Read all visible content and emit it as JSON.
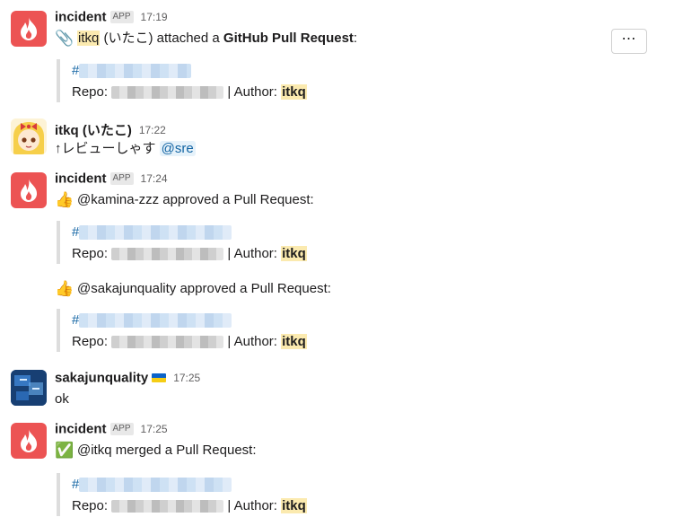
{
  "messages": [
    {
      "author": "incident",
      "badge": "APP",
      "time": "17:19",
      "emoji": "📎",
      "user_highlight": "itkq",
      "text_mid": " (いたこ) attached a ",
      "text_bold": "GitHub Pull Request",
      "text_end": ":",
      "quote": {
        "hash": "#",
        "repo_label": "Repo: ",
        "author_label": " | Author: ",
        "author": "itkq"
      }
    },
    {
      "author": "itkq (いたこ)",
      "time": "17:22",
      "text": "↑レビューしゃす ",
      "mention": "@sre"
    },
    {
      "author": "incident",
      "badge": "APP",
      "time": "17:24",
      "emoji": "👍",
      "text": "@kamina-zzz approved a Pull Request:",
      "quote": {
        "hash": "#",
        "repo_label": "Repo: ",
        "author_label": " | Author: ",
        "author": "itkq"
      },
      "emoji2": "👍",
      "text2": "@sakajunquality approved a Pull Request:",
      "quote2": {
        "hash": "#",
        "repo_label": "Repo: ",
        "author_label": " | Author: ",
        "author": "itkq"
      }
    },
    {
      "author": "sakajunquality",
      "flag": "ukraine-flag-icon",
      "time": "17:25",
      "text": "ok"
    },
    {
      "author": "incident",
      "badge": "APP",
      "time": "17:25",
      "emoji": "✅",
      "text": "@itkq merged a Pull Request:",
      "quote": {
        "hash": "#",
        "repo_label": "Repo: ",
        "author_label": " | Author: ",
        "author": "itkq"
      }
    }
  ],
  "actions": {
    "more_label": "⋯"
  },
  "colors": {
    "incident_avatar": "#ec5353",
    "link": "#1264a3",
    "highlight": "#fbeaaf"
  }
}
